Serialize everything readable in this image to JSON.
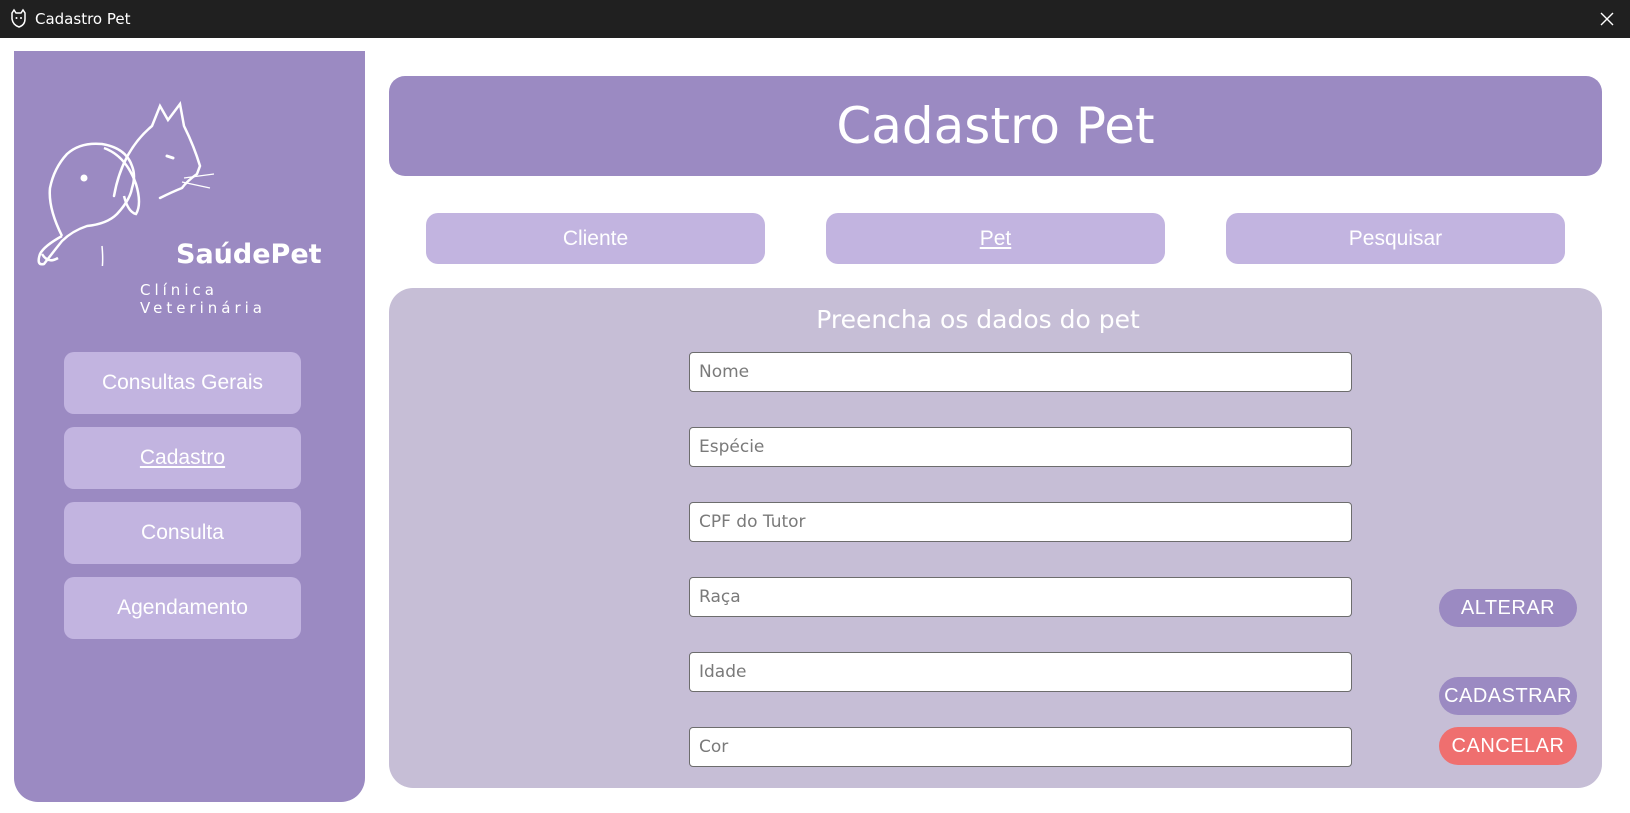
{
  "window": {
    "title": "Cadastro Pet",
    "app_icon": "pet-app-icon",
    "close_icon": "close-icon"
  },
  "colors": {
    "titlebar": "#202020",
    "sidebar": "#9b8ac2",
    "button_light": "#c2b4e0",
    "form_panel": "#c6bed6",
    "cancel": "#ef6f6f"
  },
  "sidebar": {
    "logo": {
      "brand": "SaúdePet",
      "subtitle": "Clínica Veterinária",
      "icon": "dog-cat-logo-icon"
    },
    "items": [
      {
        "label": "Consultas Gerais",
        "active": false
      },
      {
        "label": "Cadastro",
        "active": true
      },
      {
        "label": "Consulta",
        "active": false
      },
      {
        "label": "Agendamento",
        "active": false
      }
    ]
  },
  "header": {
    "title": "Cadastro Pet"
  },
  "tabs": [
    {
      "label": "Cliente",
      "active": false
    },
    {
      "label": "Pet",
      "active": true
    },
    {
      "label": "Pesquisar",
      "active": false
    }
  ],
  "form": {
    "heading": "Preencha os dados do pet",
    "fields": [
      {
        "placeholder": "Nome",
        "value": ""
      },
      {
        "placeholder": "Espécie",
        "value": ""
      },
      {
        "placeholder": "CPF do Tutor",
        "value": ""
      },
      {
        "placeholder": "Raça",
        "value": ""
      },
      {
        "placeholder": "Idade",
        "value": ""
      },
      {
        "placeholder": "Cor",
        "value": ""
      }
    ],
    "buttons": {
      "alterar": "ALTERAR",
      "cadastrar": "CADASTRAR",
      "cancelar": "CANCELAR"
    }
  }
}
